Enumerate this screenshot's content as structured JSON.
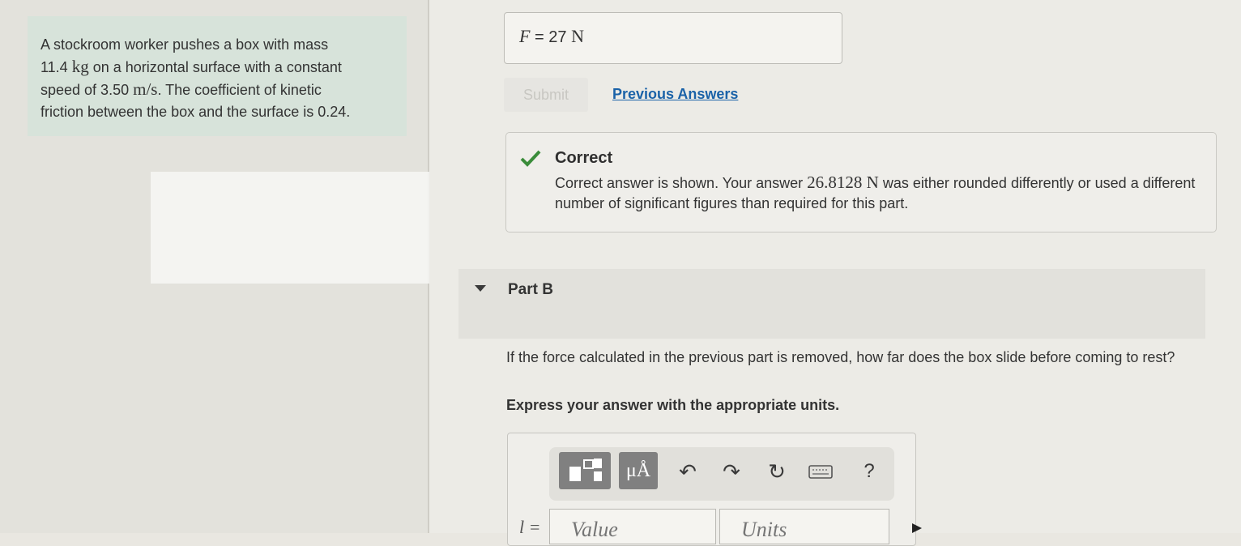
{
  "problem": {
    "text_lines": [
      "A stockroom worker pushes a box with mass",
      "on a horizontal surface with a constant",
      "speed of 3.50",
      ". The coefficient of kinetic",
      "friction between the box and the surface is 0.24."
    ],
    "mass_value": "11.4",
    "mass_unit": "kg",
    "speed_unit": "m/s"
  },
  "part_a": {
    "answer_var": "F",
    "answer_eq": "=",
    "answer_value": "27",
    "answer_unit": "N",
    "submit_label": "Submit",
    "previous_answers_label": "Previous Answers",
    "feedback": {
      "title": "Correct",
      "text_before": "Correct answer is shown. Your answer",
      "user_answer": "26.8128 N",
      "text_after": "was either rounded differently or used a different number of significant figures than required for this part."
    }
  },
  "part_b": {
    "label": "Part B",
    "question": "If the force calculated in the previous part is removed, how far does the box slide before coming to rest?",
    "instruction": "Express your answer with the appropriate units.",
    "toolbar": {
      "units_button_label": "μÅ",
      "help_label": "?",
      "icons": [
        "templates-icon",
        "units-icon",
        "undo-icon",
        "redo-icon",
        "reset-icon",
        "keyboard-icon",
        "help-icon"
      ]
    },
    "variable_label": "l =",
    "value_placeholder": "Value",
    "units_placeholder": "Units"
  },
  "colors": {
    "problem_bg": "#d7e3da",
    "link": "#1a62a8",
    "check": "#3a8c3a",
    "tool_button": "#808080"
  }
}
